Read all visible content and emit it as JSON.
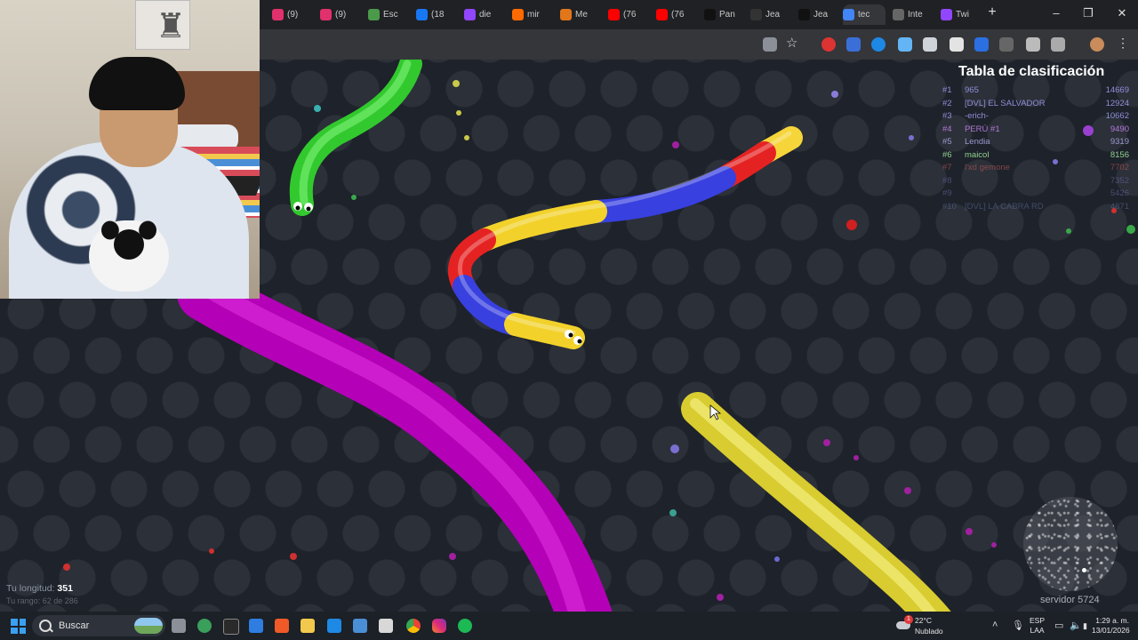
{
  "webcam": {
    "poster_icon": "eiffel-tower-icon"
  },
  "browser": {
    "tabs": [
      {
        "title": "(9)",
        "color": "#e1306c"
      },
      {
        "title": "(9)",
        "color": "#e1306c"
      },
      {
        "title": "Esc",
        "color": "#4a9a4a"
      },
      {
        "title": "(18",
        "color": "#1877f2"
      },
      {
        "title": "die",
        "color": "#9146ff"
      },
      {
        "title": "mir",
        "color": "#ff6a00"
      },
      {
        "title": "Me",
        "color": "#e2761b"
      },
      {
        "title": "(76",
        "color": "#ff0000"
      },
      {
        "title": "(76",
        "color": "#ff0000"
      },
      {
        "title": "Pan",
        "color": "#111111"
      },
      {
        "title": "Jea",
        "color": "#333333"
      },
      {
        "title": "Jea",
        "color": "#111111"
      },
      {
        "title": "tec",
        "color": "#4285f4"
      },
      {
        "title": "Inte",
        "color": "#666666"
      },
      {
        "title": "Twi",
        "color": "#9146ff"
      }
    ],
    "new_tab_icon": "plus-icon",
    "window_controls": {
      "minimize": "–",
      "maximize": "❐",
      "close": "✕"
    }
  },
  "leaderboard": {
    "title": "Tabla de clasificación",
    "rows": [
      {
        "rank": "#1",
        "name": "965",
        "score": "14669",
        "color": "#8f8fd8"
      },
      {
        "rank": "#2",
        "name": "[DVL] EL SALVADOR",
        "score": "12924",
        "color": "#8f8fd8"
      },
      {
        "rank": "#3",
        "name": "-erich-",
        "score": "10662",
        "color": "#8f8fd8"
      },
      {
        "rank": "#4",
        "name": "PERÚ #1",
        "score": "9490",
        "color": "#b07ad8"
      },
      {
        "rank": "#5",
        "name": "Lendia",
        "score": "9319",
        "color": "#9a9ad0"
      },
      {
        "rank": "#6",
        "name": "maicol",
        "score": "8156",
        "color": "#8fd08f"
      },
      {
        "rank": "#7",
        "name": "l'xd gemone",
        "score": "7702",
        "color": "#d06060"
      },
      {
        "rank": "#8",
        "name": "",
        "score": "7352",
        "color": "#6d6fb0"
      },
      {
        "rank": "#9",
        "name": "",
        "score": "5426",
        "color": "#6d6fb0"
      },
      {
        "rank": "#10",
        "name": "[DVL] LA CABRA RD",
        "score": "4871",
        "color": "#5d6fa0"
      }
    ]
  },
  "player": {
    "length_label": "Tu longitud:",
    "length_value": "351",
    "rank_text": "Tu rango: 62 de 286"
  },
  "server": "servidor 5724",
  "taskbar": {
    "search_placeholder": "Buscar",
    "weather": {
      "badge": "1",
      "temp": "22°C",
      "condition": "Nublado"
    },
    "lang_line1": "ESP",
    "lang_line2": "LAA",
    "time": "1:29 a. m.",
    "date": "13/01/2026"
  },
  "colors": {
    "snake_green": "#3fd13a",
    "snake_magenta": "#b900b9",
    "snake_yellow": "#e0d53a",
    "snake_red": "#e02525",
    "snake_blue": "#3a44e6",
    "snake_gold": "#f0d72a"
  }
}
